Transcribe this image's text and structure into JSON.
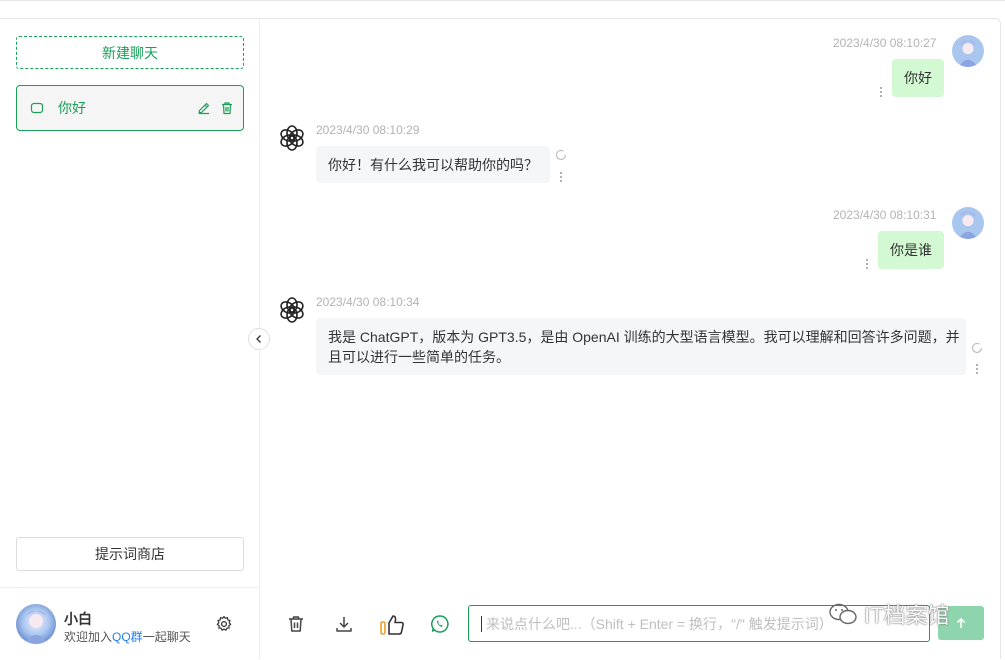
{
  "sidebar": {
    "new_chat_label": "新建聊天",
    "chats": [
      {
        "title": "你好"
      }
    ],
    "prompt_store_label": "提示词商店",
    "user": {
      "name": "小白",
      "desc_prefix": "欢迎加入",
      "desc_link": "QQ群",
      "desc_suffix": "一起聊天"
    }
  },
  "messages": [
    {
      "role": "user",
      "time": "2023/4/30 08:10:27",
      "text": "你好"
    },
    {
      "role": "assistant",
      "time": "2023/4/30 08:10:29",
      "text": "你好！有什么我可以帮助你的吗？"
    },
    {
      "role": "user",
      "time": "2023/4/30 08:10:31",
      "text": "你是谁"
    },
    {
      "role": "assistant",
      "time": "2023/4/30 08:10:34",
      "text_line1": "我是 ChatGPT，版本为 GPT3.5，是由 OpenAI 训练的大型语言模型。我可以理解和回答许多问题，并",
      "text_line2": "且可以进行一些简单的任务。"
    }
  ],
  "composer": {
    "placeholder": "来说点什么吧...（Shift + Enter = 换行，\"/\" 触发提示词）"
  },
  "watermark": "IT档案馆",
  "colors": {
    "accent": "#18a058",
    "user_bubble": "#d2f9d1",
    "ai_bubble": "#f4f6f8"
  },
  "icons": [
    "chat-bubble-icon",
    "edit-icon",
    "trash-icon",
    "gear-icon",
    "chevron-left-icon",
    "openai-logo-icon",
    "more-vertical-icon",
    "refresh-icon",
    "delete-icon",
    "download-icon",
    "thumb-icon",
    "whatsapp-icon",
    "send-icon"
  ]
}
